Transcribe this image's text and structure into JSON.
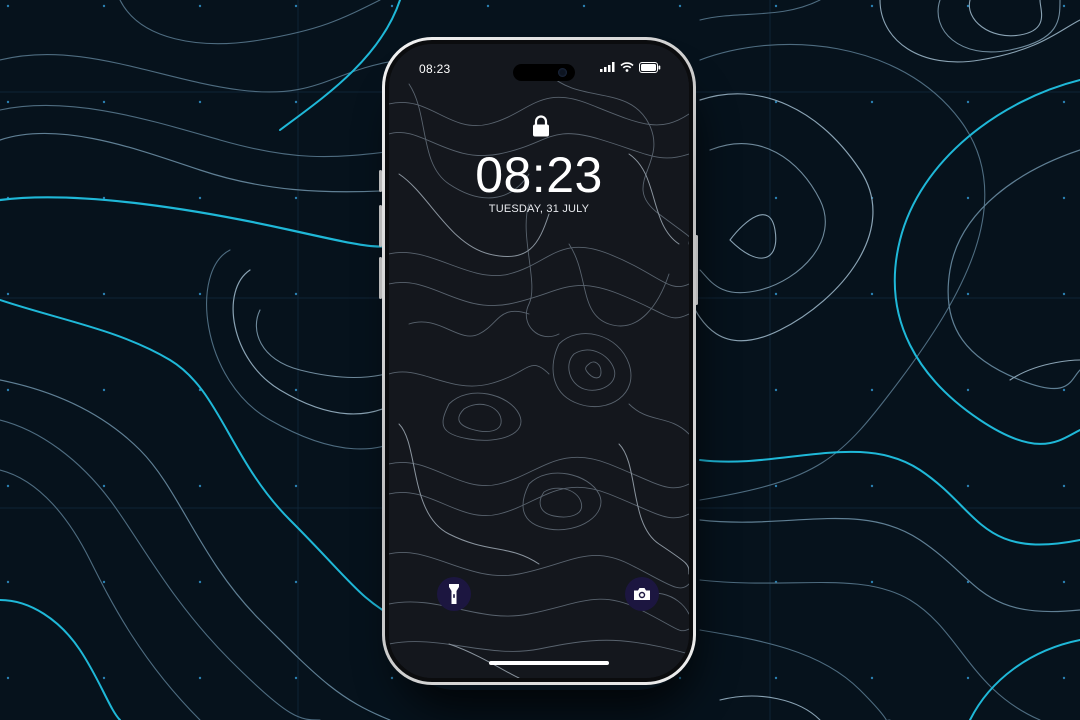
{
  "status_bar": {
    "time": "08:23",
    "icons": [
      "signal-bars-icon",
      "wifi-icon",
      "battery-icon"
    ]
  },
  "lock_screen": {
    "lock_icon": "lock-icon",
    "time": "08:23",
    "date": "TUESDAY, 31 JULY"
  },
  "quick_actions": {
    "flashlight": {
      "icon": "flashlight-icon"
    },
    "camera": {
      "icon": "camera-icon"
    }
  },
  "colors": {
    "background": "#06121c",
    "contour_accent": "#1fb8d8",
    "screen_background": "#14171d",
    "quick_action_bg": "#1c1640",
    "phone_frame": "#d9d9d9"
  }
}
